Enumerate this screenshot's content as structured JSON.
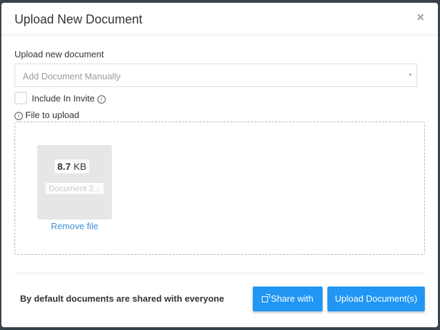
{
  "modal": {
    "title": "Upload New Document",
    "close_label": "×"
  },
  "form": {
    "upload_label": "Upload new document",
    "select_value": "Add Document Manually",
    "include_invite_label": "Include In Invite",
    "info_glyph": "i",
    "file_label": "File to upload"
  },
  "file": {
    "size_value": "8.7",
    "size_unit": "KB",
    "name": "Document 2...",
    "remove_label": "Remove file"
  },
  "footer": {
    "note": "By default documents are shared with everyone",
    "share_label": "Share with",
    "upload_label": "Upload Document(s)"
  },
  "colors": {
    "primary": "#2196f3",
    "link": "#3d8fd6",
    "backdrop": "#3f4a55"
  },
  "icons": {
    "close": "close-icon",
    "info": "info-icon",
    "share": "share-icon",
    "caret": "chevron-down-icon"
  }
}
